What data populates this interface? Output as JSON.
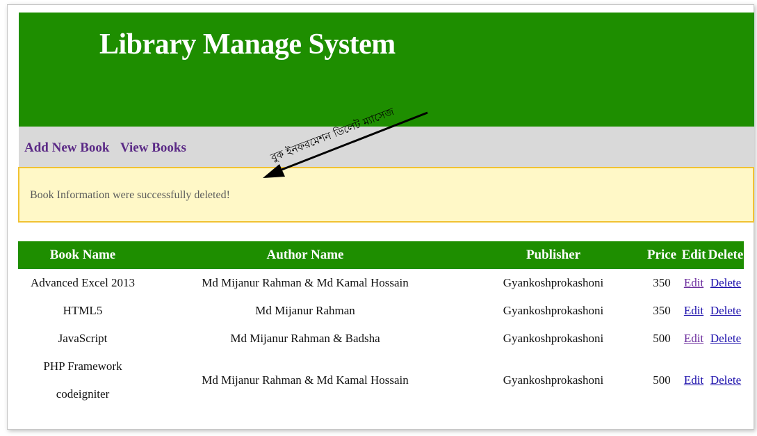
{
  "app": {
    "title": "Library Manage System"
  },
  "nav": {
    "add_label": "Add New Book",
    "view_label": "View Books"
  },
  "message": {
    "text": "Book Information were successfully deleted!"
  },
  "annotation": {
    "text": "বুক ইনফরমেশন ডিলেট ম্যাসেজ"
  },
  "table": {
    "headers": [
      "Book Name",
      "Author Name",
      "Publisher",
      "Price",
      "Edit",
      "Delete"
    ],
    "rows": [
      {
        "book_line1": "Advanced Excel 2013",
        "book_line2": "",
        "author": "Md Mijanur Rahman & Md Kamal Hossain",
        "publisher": "Gyankoshprokashoni",
        "price": "350",
        "edit": "Edit",
        "delete": "Delete"
      },
      {
        "book_line1": "HTML5",
        "book_line2": "",
        "author": "Md Mijanur Rahman",
        "publisher": "Gyankoshprokashoni",
        "price": "350",
        "edit": "Edit",
        "delete": "Delete"
      },
      {
        "book_line1": "JavaScript",
        "book_line2": "",
        "author": "Md Mijanur Rahman & Badsha",
        "publisher": "Gyankoshprokashoni",
        "price": "500",
        "edit": "Edit",
        "delete": "Delete"
      },
      {
        "book_line1": "PHP Framework",
        "book_line2": "codeigniter",
        "author": "Md Mijanur Rahman & Md Kamal Hossain",
        "publisher": "Gyankoshprokashoni",
        "price": "500",
        "edit": "Edit",
        "delete": "Delete"
      }
    ]
  },
  "colors": {
    "header_green": "#1e8e00",
    "nav_gray": "#d9d9d9",
    "message_bg": "#fff8c7",
    "message_border": "#f1c232",
    "link_blue": "#1a0dab",
    "nav_link_purple": "#5b2a86"
  }
}
